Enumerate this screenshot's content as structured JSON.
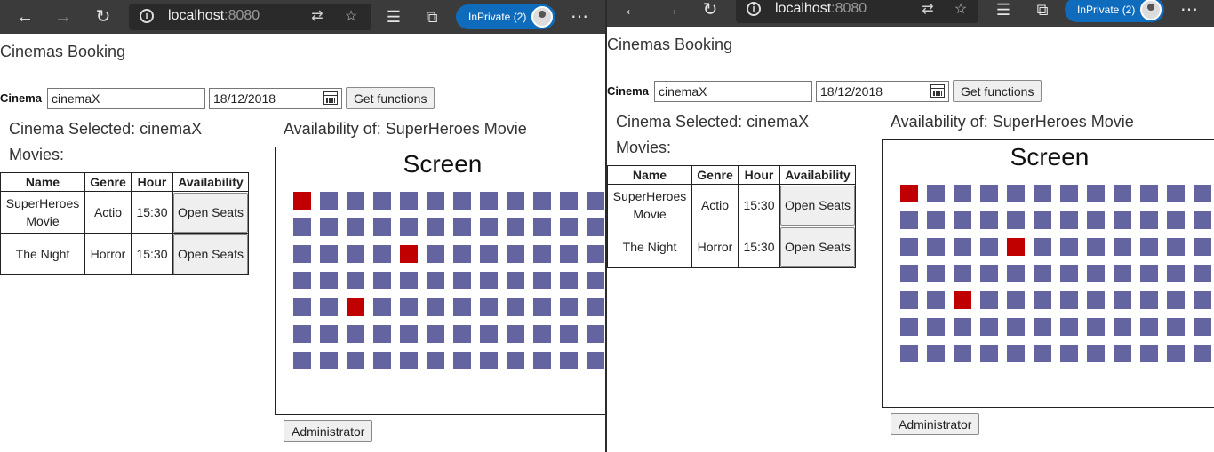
{
  "browser": {
    "url_host": "localhost",
    "url_port": ":8080",
    "inprivate_label": "InPrivate (2)"
  },
  "app": {
    "title": "Cinemas Booking",
    "cinema_label": "Cinema",
    "cinema_value": "cinemaX",
    "date_value": "18/12/2018",
    "get_functions_label": "Get functions",
    "cinema_selected": "Cinema Selected: cinemaX",
    "movies_label": "Movies:",
    "availability_title": "Availability of: SuperHeroes Movie",
    "screen_label": "Screen",
    "administrator_label": "Administrator"
  },
  "table": {
    "headers": [
      "Name",
      "Genre",
      "Hour",
      "Availability"
    ],
    "rows": [
      {
        "name": "SuperHeroes Movie",
        "genre": "Actio",
        "hour": "15:30",
        "action": "Open Seats"
      },
      {
        "name": "The Night",
        "genre": "Horror",
        "hour": "15:30",
        "action": "Open Seats"
      }
    ]
  },
  "seats": {
    "rows": 7,
    "cols": 12,
    "taken_left": [
      [
        0,
        0
      ],
      [
        2,
        4
      ],
      [
        4,
        2
      ]
    ],
    "taken_right": [
      [
        0,
        0
      ],
      [
        2,
        4
      ],
      [
        4,
        2
      ]
    ]
  },
  "colors": {
    "seat_free": "#6464a0",
    "seat_taken": "#c00000",
    "inprivate": "#0f6cbd"
  }
}
